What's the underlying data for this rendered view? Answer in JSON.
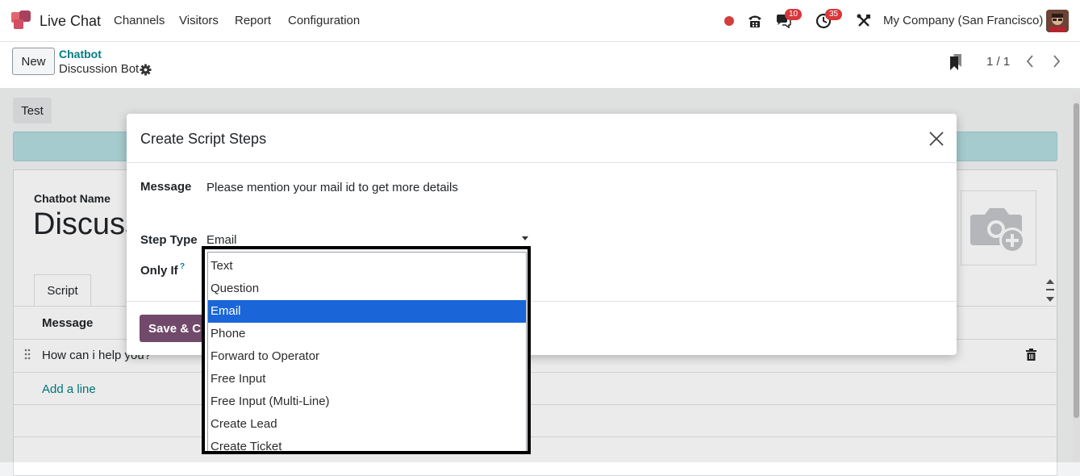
{
  "navbar": {
    "app_name": "Live Chat",
    "menu": [
      "Channels",
      "Visitors",
      "Report",
      "Configuration"
    ],
    "badges": {
      "messages": "10",
      "activities": "35"
    },
    "company": "My Company (San Francisco)"
  },
  "control_panel": {
    "new_label": "New",
    "breadcrumb_parent": "Chatbot",
    "breadcrumb_current": "Discussion Bot",
    "pager": "1 / 1"
  },
  "form": {
    "test_label": "Test",
    "chatbot_name_label": "Chatbot Name",
    "chatbot_name_value": "Discussion Bot",
    "tab_script": "Script",
    "list_header_message": "Message",
    "row_message": "How can i help you?",
    "add_line": "Add a line"
  },
  "modal": {
    "title": "Create Script Steps",
    "message_label": "Message",
    "message_value": "Please mention your mail id to get more details",
    "step_type_label": "Step Type",
    "step_type_value": "Email",
    "only_if_label": "Only If",
    "only_if_help": "?",
    "save_label": "Save & Close"
  },
  "dropdown": {
    "options": [
      "Text",
      "Question",
      "Email",
      "Phone",
      "Forward to Operator",
      "Free Input",
      "Free Input (Multi-Line)",
      "Create Lead",
      "Create Ticket"
    ],
    "selected": "Email"
  },
  "colors": {
    "accent": "#71496a",
    "link": "#017e84",
    "selection": "#1a66d9"
  }
}
